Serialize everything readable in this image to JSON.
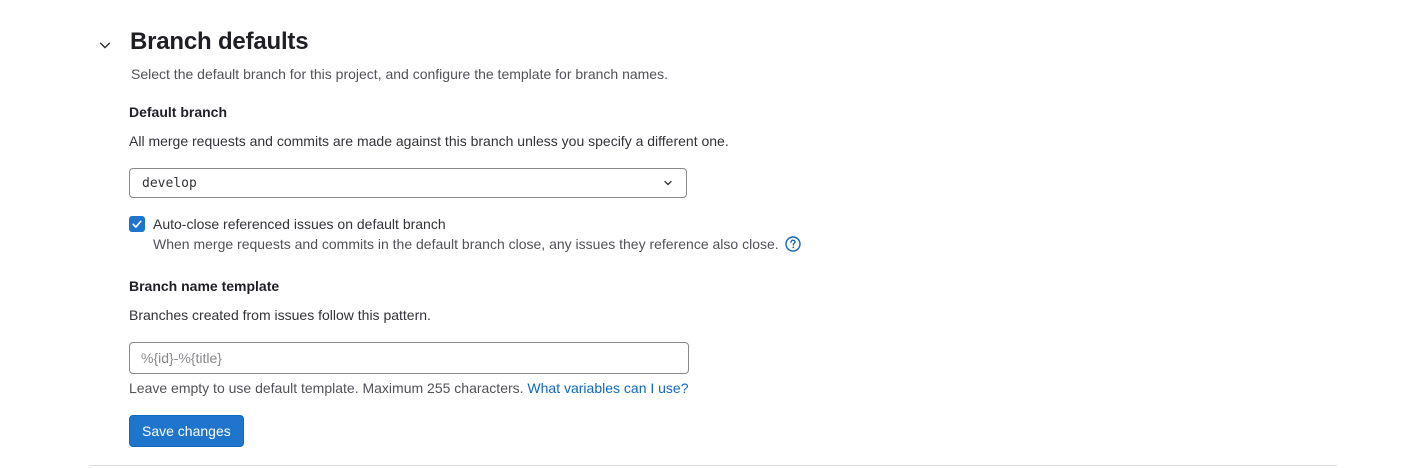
{
  "section": {
    "title": "Branch defaults",
    "description": "Select the default branch for this project, and configure the template for branch names."
  },
  "default_branch": {
    "label": "Default branch",
    "help": "All merge requests and commits are made against this branch unless you specify a different one.",
    "selected": "develop"
  },
  "auto_close": {
    "checked": true,
    "label": "Auto-close referenced issues on default branch",
    "help": "When merge requests and commits in the default branch close, any issues they reference also close."
  },
  "branch_template": {
    "label": "Branch name template",
    "help": "Branches created from issues follow this pattern.",
    "value": "",
    "placeholder": "%{id}-%{title}",
    "footer_text": "Leave empty to use default template. Maximum 255 characters. ",
    "footer_link": "What variables can I use?"
  },
  "actions": {
    "save_label": "Save changes"
  },
  "colors": {
    "primary": "#1f75cb",
    "link": "#1068bf",
    "border": "#89888d",
    "divider": "#dcdcde"
  },
  "icons": {
    "collapse": "chevron-down-icon",
    "select_caret": "chevron-down-icon",
    "checkbox": "check-icon",
    "help": "question-circle-icon"
  }
}
